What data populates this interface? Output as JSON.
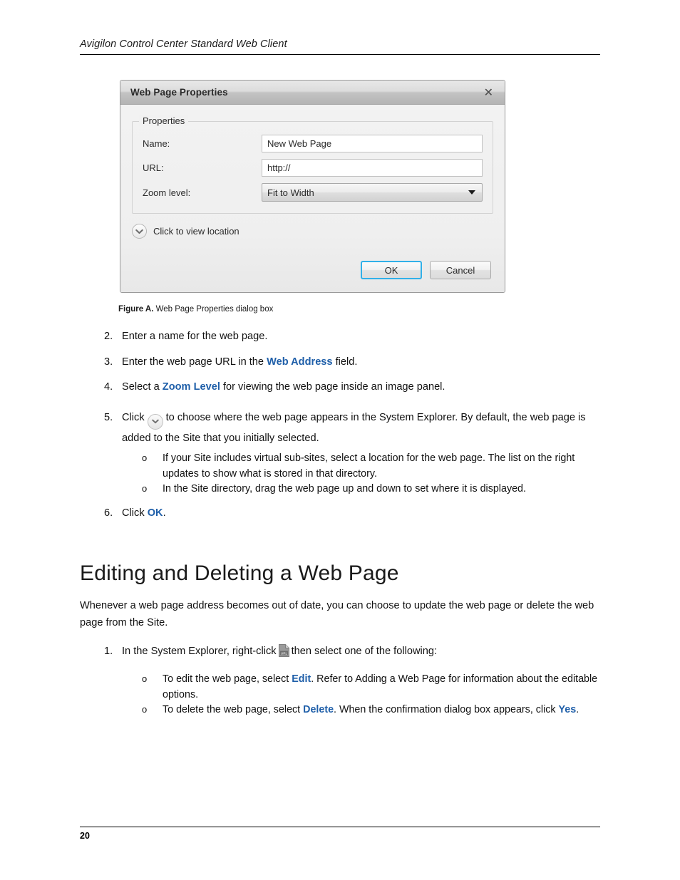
{
  "header": {
    "title": "Avigilon Control Center Standard Web Client"
  },
  "dialog": {
    "title": "Web Page Properties",
    "close_icon": "close-icon",
    "groupbox_legend": "Properties",
    "fields": {
      "name_label": "Name:",
      "name_value": "New Web Page",
      "url_label": "URL:",
      "url_value": "http://",
      "zoom_label": "Zoom level:",
      "zoom_value": "Fit to Width",
      "zoom_options": [
        "Fit to Width"
      ]
    },
    "view_location_label": "Click to view location",
    "view_location_icon": "chevron-down-circle-icon",
    "ok_label": "OK",
    "cancel_label": "Cancel",
    "default_button_border_color": "#31b0e8"
  },
  "figure": {
    "label": "Figure A.",
    "caption": "Web Page Properties dialog box"
  },
  "steps": {
    "item2": {
      "marker": "2.",
      "text": "Enter a name for the web page."
    },
    "item3": {
      "marker": "3.",
      "text_before": "Enter the web page URL in the ",
      "keyword": "Web Address",
      "text_after": " field."
    },
    "item4": {
      "marker": "4.",
      "text_before": "Select a ",
      "keyword": "Zoom Level",
      "text_after": " for viewing the web page inside an image panel."
    },
    "item5": {
      "marker": "5.",
      "text_before": "Click",
      "icon": "chevron-down-circle-icon",
      "text_after": "to choose where the web page appears in the System Explorer. By default, the web page is added to the Site that you initially selected."
    },
    "item5_sub": [
      {
        "marker": "o",
        "text": "If your Site includes virtual sub-sites, select a location for the web page. The list on the right updates to show what is stored in that directory."
      },
      {
        "marker": "o",
        "text": "In the Site directory, drag the web page up and down to set where it is displayed."
      }
    ],
    "item6": {
      "marker": "6.",
      "text_before": "Click ",
      "keyword": "OK",
      "text_after": "."
    }
  },
  "section": {
    "heading": "Editing and Deleting a Web Page",
    "paragraph": "Whenever a web page address becomes out of date, you can choose to update the web page or delete the web page from the Site.",
    "item1": {
      "marker": "1.",
      "text_before": "In the System Explorer, right-click",
      "icon": "url-document-icon",
      "text_after": "then select one of the following:"
    },
    "item1_sub": [
      {
        "marker": "o",
        "text_before": "To edit the web page, select ",
        "keyword": "Edit",
        "text_after": ". Refer to Adding a Web Page for information about the editable options."
      },
      {
        "marker": "o",
        "text_before": "To delete the web page, select ",
        "keyword": "Delete",
        "text_mid": ". When the confirmation dialog box appears, click ",
        "keyword2": "Yes",
        "text_after": "."
      }
    ]
  },
  "footer": {
    "page_number": "20"
  },
  "colors": {
    "keyword_blue": "#1f5fa9",
    "rule_black": "#000000"
  }
}
